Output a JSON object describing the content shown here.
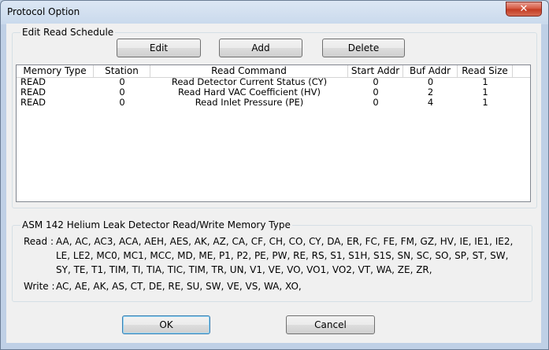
{
  "window": {
    "title": "Protocol Option",
    "close_glyph": "✕"
  },
  "edit_group": {
    "title": "Edit Read Schedule",
    "edit_label": "Edit",
    "add_label": "Add",
    "delete_label": "Delete"
  },
  "table": {
    "columns": [
      "Memory Type",
      "Station",
      "Read Command",
      "Start Addr",
      "Buf Addr",
      "Read Size"
    ],
    "rows": [
      [
        "READ",
        "0",
        "Read Detector Current Status (CY)",
        "0",
        "0",
        "1"
      ],
      [
        "READ",
        "0",
        "Read Hard VAC Coefficient (HV)",
        "0",
        "2",
        "1"
      ],
      [
        "READ",
        "0",
        "Read Inlet Pressure (PE)",
        "0",
        "4",
        "1"
      ]
    ]
  },
  "memory_group": {
    "title": "ASM 142 Helium Leak Detector Read/Write Memory Type",
    "read_label": "Read :",
    "read_lines": [
      "AA, AC, AC3, ACA, AEH, AES, AK, AZ, CA, CF, CH, CO, CY, DA, ER, FC, FE, FM, GZ, HV, IE, IE1, IE2,",
      "LE, LE2, MC0, MC1, MCC, MD, ME, P1, P2, PE, PW, RE, RS, S1, S1H, S1S, SN, SC, SO, SP, ST, SW,",
      "SY, TE, T1, TIM, TI, TIA, TIC, TIM, TR, UN, V1, VE, VO, VO1, VO2, VT, WA, ZE, ZR,"
    ],
    "write_label": "Write :",
    "write_line": "AC, AE, AK, AS, CT, DE, RE, SU, SW, VE, VS, WA, XO,"
  },
  "footer": {
    "ok_label": "OK",
    "cancel_label": "Cancel"
  },
  "icons": {
    "close": "close-icon"
  }
}
